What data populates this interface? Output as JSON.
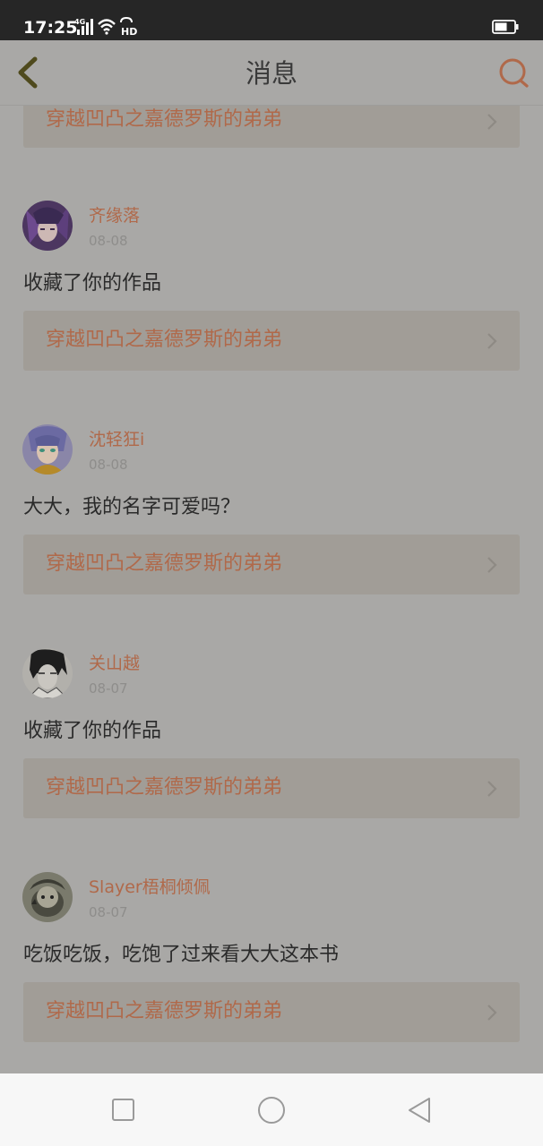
{
  "status_bar": {
    "time": "17:25",
    "network_label": "4G",
    "hd_label": "HD",
    "icons": [
      "signal-icon",
      "wifi-icon",
      "hd-call-icon",
      "battery-icon"
    ]
  },
  "navbar": {
    "title": "消息",
    "back_icon": "chevron-left-icon",
    "search_icon": "search-icon"
  },
  "colors": {
    "accent": "#b0694a",
    "background": "#a9a8a6",
    "link_background": "#a19d97"
  },
  "messages": [
    {
      "username": "",
      "date": "",
      "text": "",
      "work_title": "穿越凹凸之嘉德罗斯的弟弟"
    },
    {
      "username": "齐缘落",
      "date": "08-08",
      "text": "收藏了你的作品",
      "work_title": "穿越凹凸之嘉德罗斯的弟弟"
    },
    {
      "username": "沈轻狂i",
      "date": "08-08",
      "text": "大大，我的名字可爱吗？",
      "work_title": "穿越凹凸之嘉德罗斯的弟弟"
    },
    {
      "username": "关山越",
      "date": "08-07",
      "text": "收藏了你的作品",
      "work_title": "穿越凹凸之嘉德罗斯的弟弟"
    },
    {
      "username": "Slayer梧桐倾佩",
      "date": "08-07",
      "text": "吃饭吃饭，吃饱了过来看大大这本书",
      "work_title": "穿越凹凸之嘉德罗斯的弟弟"
    }
  ],
  "system_nav": {
    "buttons": [
      "recents-square-icon",
      "home-circle-icon",
      "back-triangle-icon"
    ]
  }
}
